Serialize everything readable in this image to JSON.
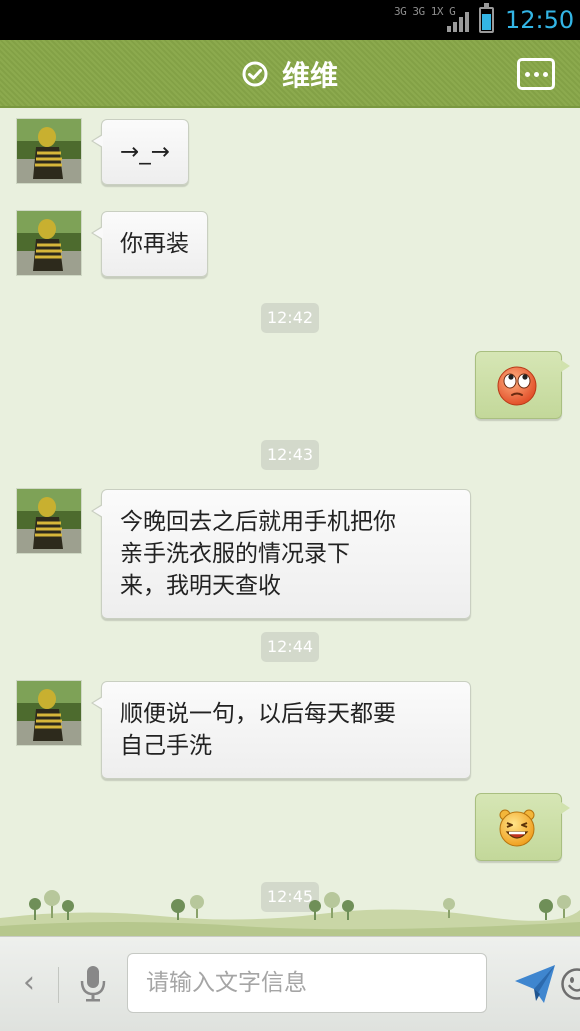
{
  "status_bar": {
    "network": "3G 3G 1X G",
    "time": "12:50",
    "battery_level": 0.75
  },
  "header": {
    "contact_name": "维维",
    "more_icon": "more-icon",
    "verified_icon": "check-circle-icon"
  },
  "messages": [
    {
      "side": "in",
      "type": "text",
      "text": "→_→"
    },
    {
      "side": "in",
      "type": "text",
      "text": "你再装"
    },
    {
      "type": "timestamp",
      "text": "12:42"
    },
    {
      "side": "out",
      "type": "emoji",
      "emoji": "rolling-eyes-emoji"
    },
    {
      "type": "timestamp",
      "text": "12:43"
    },
    {
      "side": "in",
      "type": "text",
      "lines": [
        "今晚回去之后就用手机把你",
        "亲手洗衣服的情况录下",
        "来，我明天查收"
      ]
    },
    {
      "type": "timestamp",
      "text": "12:44"
    },
    {
      "side": "in",
      "type": "text",
      "lines": [
        "顺便说一句，以后每天都要",
        "自己手洗"
      ]
    },
    {
      "side": "out",
      "type": "emoji",
      "emoji": "laughing-emoji"
    },
    {
      "type": "timestamp",
      "text": "12:45"
    }
  ],
  "input_bar": {
    "placeholder": "请输入文字信息",
    "icons": [
      "back-icon",
      "microphone-icon",
      "smiley-icon",
      "send-icon"
    ]
  },
  "colors": {
    "header_green": "#86a44a",
    "status_blue": "#33b5e5",
    "chat_background": "#e9f0de",
    "outgoing_bubble": "#cbdfa6"
  }
}
